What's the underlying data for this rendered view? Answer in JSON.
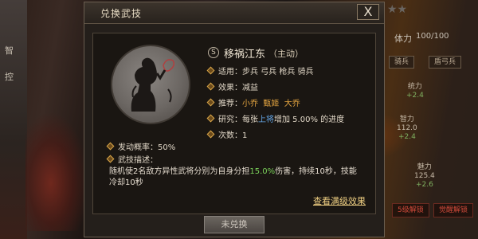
{
  "background": {
    "left_labels": [
      "智",
      "控"
    ],
    "stars": "★★",
    "stamina": {
      "label": "体力",
      "value": "100/100"
    },
    "chips": [
      "骑兵",
      "盾弓兵"
    ],
    "attrs": [
      {
        "label": "统力",
        "value": "",
        "plus": "+2.4"
      },
      {
        "label": "智力",
        "value": "112.0",
        "plus": "+2.4"
      },
      {
        "label": "魅力",
        "value": "125.4",
        "plus": "+2.6"
      }
    ],
    "unlocks": [
      "5级解锁",
      "觉醒解锁"
    ]
  },
  "dialog": {
    "title": "兑换武技",
    "close_label": "X",
    "skill": {
      "badge": "S",
      "name": "移祸江东",
      "tag": "（主动）"
    },
    "rows": {
      "apply_label": "适用：",
      "apply_value": "步兵 弓兵 枪兵 骑兵",
      "effect_label": "效果：",
      "effect_value": "减益",
      "recommend_label": "推荐：",
      "recommend_values": [
        "小乔",
        "甄姬",
        "大乔"
      ],
      "research_label": "研究：",
      "research_prefix": "每张",
      "research_highlight": "上将",
      "research_suffix": "增加 5.00% 的进度",
      "count_label": "次数：",
      "count_value": "1",
      "trigger_label": "发动概率：",
      "trigger_value": "50%",
      "desc_label": "武技描述："
    },
    "description": {
      "part1": "随机使2名敌方异性武将分别为自身分担",
      "highlight": "15.0%",
      "part2": "伤害，持续10秒，技能冷却10秒"
    },
    "full_effect_link": "查看满级效果",
    "exchange_button": "未兑换"
  },
  "colors": {
    "gold": "#e3a440",
    "blue": "#64a6e6",
    "green": "#7bd15a",
    "link": "#efcf82"
  }
}
